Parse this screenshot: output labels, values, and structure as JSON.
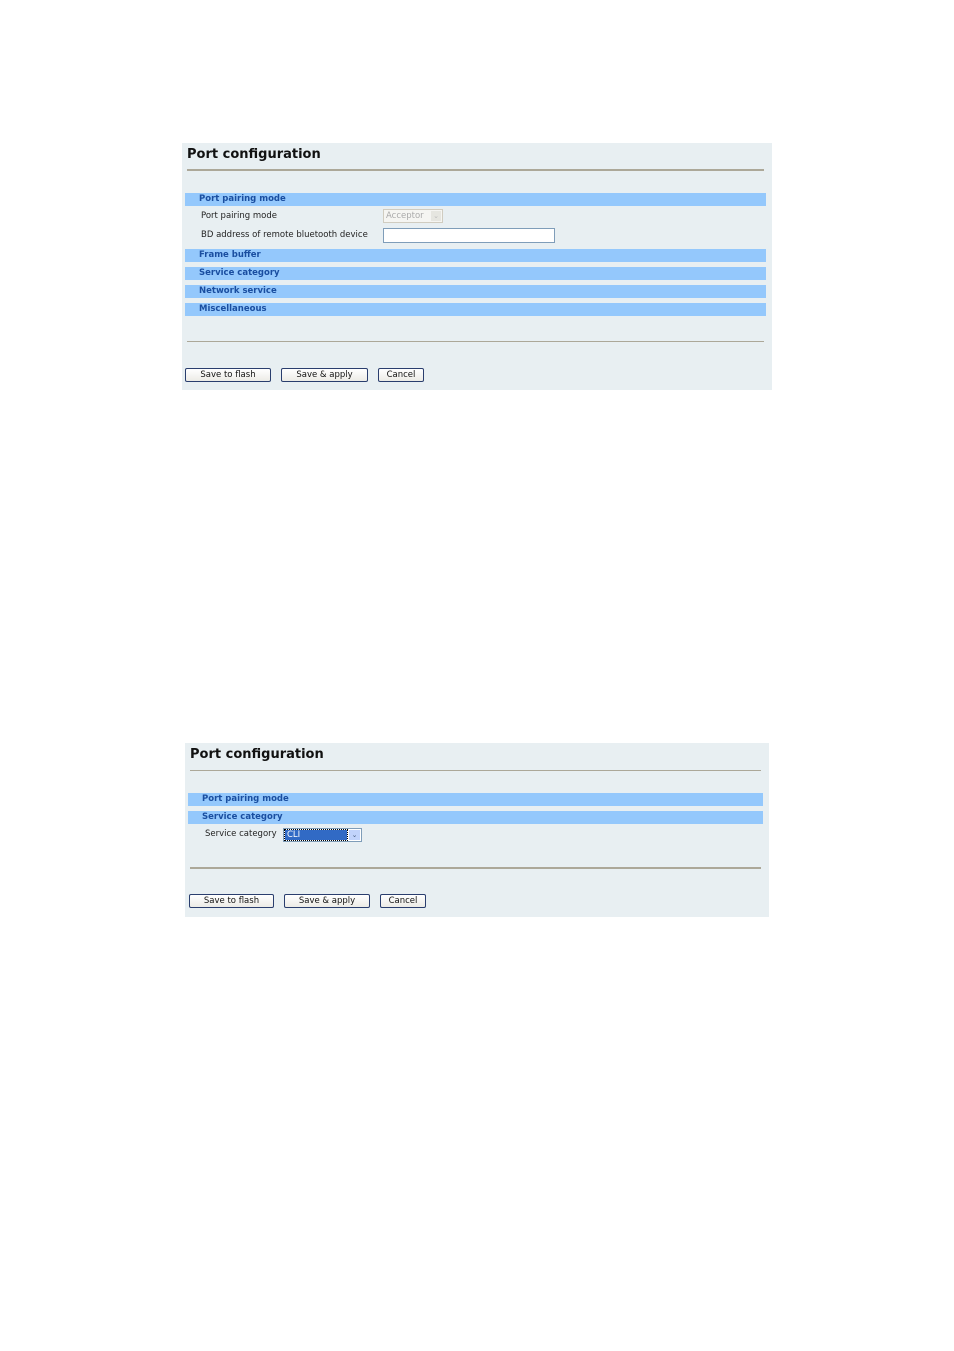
{
  "panel1": {
    "title": "Port configuration",
    "sections": {
      "port_pairing_mode": "Port pairing mode",
      "frame_buffer": "Frame buffer",
      "service_category": "Service category",
      "network_service": "Network service",
      "miscellaneous": "Miscellaneous"
    },
    "fields": {
      "port_pairing_mode_label": "Port pairing mode",
      "port_pairing_mode_value": "Acceptor",
      "bd_address_label": "BD address of remote bluetooth device",
      "bd_address_value": ""
    },
    "buttons": {
      "save_to_flash": "Save to flash",
      "save_apply": "Save & apply",
      "cancel": "Cancel"
    }
  },
  "panel2": {
    "title": "Port configuration",
    "sections": {
      "port_pairing_mode": "Port pairing mode",
      "service_category": "Service category"
    },
    "fields": {
      "service_category_label": "Service category",
      "service_category_value": "CLI"
    },
    "buttons": {
      "save_to_flash": "Save to flash",
      "save_apply": "Save & apply",
      "cancel": "Cancel"
    }
  },
  "icons": {
    "dropdown_arrow": "⌄"
  }
}
